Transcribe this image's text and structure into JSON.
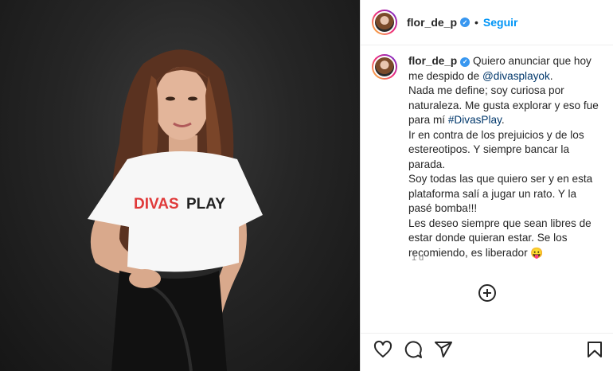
{
  "post": {
    "username": "flor_de_p",
    "verified_badge": "verified-badge-icon",
    "follow_label": "Seguir",
    "separator": "•",
    "photo_shirt_text": "DIVASPLAY",
    "caption": {
      "username": "flor_de_p",
      "line1_prefix": "Quiero anunciar que hoy me despido de ",
      "mention": "@divasplayok",
      "line1_suffix": ".",
      "line2_prefix": "Nada me define; soy curiosa por naturaleza. Me gusta explorar y eso fue para mí ",
      "hashtag": "#DivasPlay",
      "line2_suffix": ".",
      "line3": "Ir en contra de los prejuicios y de los estereotipos. Y siempre bancar la parada.",
      "line4": "Soy todas las que quiero ser y en esta plataforma salí a jugar un rato. Y la pasé bomba!!!",
      "line5": "Les deseo siempre que sean libres de estar donde quieran estar. Se los recomiendo, es liberador",
      "emoji": "😛"
    },
    "time_ago": "1 d",
    "icons": {
      "add_comment": "add-circle-icon",
      "like": "heart-icon",
      "comment": "comment-icon",
      "share": "share-icon",
      "save": "bookmark-icon"
    },
    "colors": {
      "link_blue": "#0095f6",
      "mention": "#00376b",
      "verified": "#3897f0",
      "shirt_red": "#e03a3a"
    }
  }
}
